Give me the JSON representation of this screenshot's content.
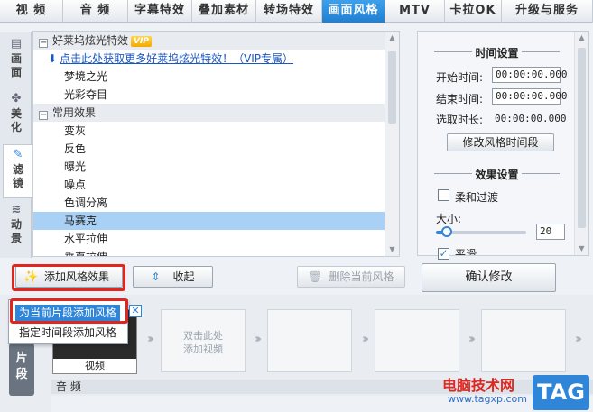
{
  "tabs": [
    {
      "label": "视 频",
      "width": 70,
      "active": false
    },
    {
      "label": "音 频",
      "width": 72,
      "active": false
    },
    {
      "label": "字幕特效",
      "width": 71,
      "active": false
    },
    {
      "label": "叠加素材",
      "width": 71,
      "active": false
    },
    {
      "label": "转场特效",
      "width": 73,
      "active": false
    },
    {
      "label": "画面风格",
      "width": 70,
      "active": true
    },
    {
      "label": "MTV",
      "width": 66,
      "active": false
    },
    {
      "label": "卡拉OK",
      "width": 63,
      "active": false
    },
    {
      "label": "升级与服务",
      "width": 101,
      "active": false
    }
  ],
  "side_tabs": [
    {
      "label": "画面",
      "icon": "film-icon"
    },
    {
      "label": "美化",
      "icon": "sparkle-icon"
    },
    {
      "label": "滤镜",
      "icon": "magic-wand-icon"
    },
    {
      "label": "动景",
      "icon": "waves-icon"
    }
  ],
  "effects_list": {
    "group1": {
      "label": "好莱坞炫光特效",
      "badge": "VIP",
      "expanded": true
    },
    "link": "点击此处获取更多好莱坞炫光特效！（VIP专属）",
    "group1_items": [
      "梦境之光",
      "光彩夺目"
    ],
    "group2": {
      "label": "常用效果",
      "expanded": true
    },
    "group2_items": [
      "变灰",
      "反色",
      "曝光",
      "噪点",
      "色调分离",
      "马赛克",
      "水平拉伸",
      "垂直拉伸"
    ],
    "selected": "马赛克"
  },
  "time_settings": {
    "title": "时间设置",
    "start_label": "开始时间:",
    "start_value": "00:00:00.000",
    "end_label": "结束时间:",
    "end_value": "00:00:00.000",
    "duration_label": "选取时长:",
    "duration_value": "00:00:00.000",
    "modify_button": "修改风格时间段"
  },
  "effect_settings": {
    "title": "效果设置",
    "smooth_label": "柔和过渡",
    "smooth_checked": false,
    "size_label": "大小:",
    "size_value": "20",
    "size_level_fraction": 0.12,
    "third_label": "平滑",
    "third_checked": true
  },
  "confirm_button": "确认修改",
  "toolbar": {
    "add_style": "添加风格效果",
    "collapse": "收起",
    "delete_style": "删除当前风格"
  },
  "dropdown": {
    "items": [
      "为当前片段添加风格",
      "指定时间段添加风格"
    ],
    "highlighted": 0
  },
  "timeline": {
    "clip_tab": "片段",
    "first_clip_label": "视频",
    "placeholder_text": "双击此处\n添加视频",
    "audio_label": "音 频"
  },
  "watermark": {
    "line1": "电脑技术网",
    "line2": "www.tagxp.com",
    "tag": "TAG"
  },
  "colors": {
    "accent": "#1f7fd2",
    "highlight_red": "#e0261f",
    "selection": "#a9d1f6"
  }
}
